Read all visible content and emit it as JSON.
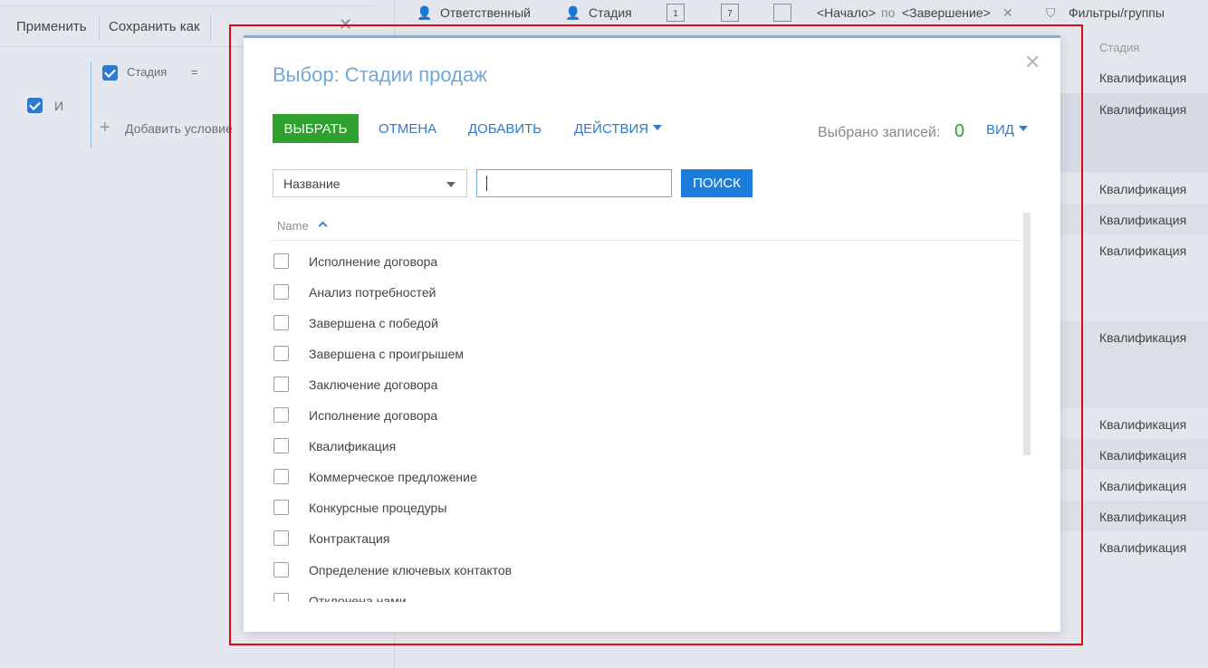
{
  "filter_panel": {
    "apply_label": "Применить",
    "save_as_label": "Сохранить как",
    "condition_label": "И",
    "stage_label": "Стадия",
    "operator": "=",
    "add_condition_label": "Добавить условие"
  },
  "toolbar": {
    "responsible_label": "Ответственный",
    "stage_label": "Стадия",
    "calendar_day": "1",
    "calendar_week": "7",
    "period_start": "<Начало>",
    "period_by": "по",
    "period_end": "<Завершение>",
    "filters_label": "Фильтры/группы"
  },
  "grid": {
    "column_header": "Стадия",
    "rows": [
      "Квалификация",
      "Квалификация",
      "Квалификация",
      "Квалификация",
      "Квалификация",
      "Квалификация",
      "Квалификация",
      "Квалификация",
      "Квалификация",
      "Квалификация",
      "Квалификация",
      "Квалификация"
    ]
  },
  "modal": {
    "title": "Выбор: Стадии продаж",
    "select_button": "ВЫБРАТЬ",
    "cancel_button": "ОТМЕНА",
    "add_button": "ДОБАВИТЬ",
    "actions_button": "ДЕЙСТВИЯ",
    "selected_label": "Выбрано записей:",
    "selected_count": "0",
    "view_button": "ВИД",
    "search_field": "Название",
    "search_value": "",
    "search_button": "ПОИСК",
    "column_name": "Name",
    "items": [
      "Исполнение договора",
      "Анализ потребностей",
      "Завершена с победой",
      "Завершена с проигрышем",
      "Заключение договора",
      "Исполнение договора",
      "Квалификация",
      "Коммерческое предложение",
      "Конкурсные процедуры",
      "Контрактация",
      "Определение ключевых контактов",
      "Отклонена нами"
    ]
  },
  "colors": {
    "select_green": "#2ea12e",
    "link_blue": "#2f7bc9",
    "title_blue": "#72a7d6",
    "highlight_red": "#e30613"
  }
}
